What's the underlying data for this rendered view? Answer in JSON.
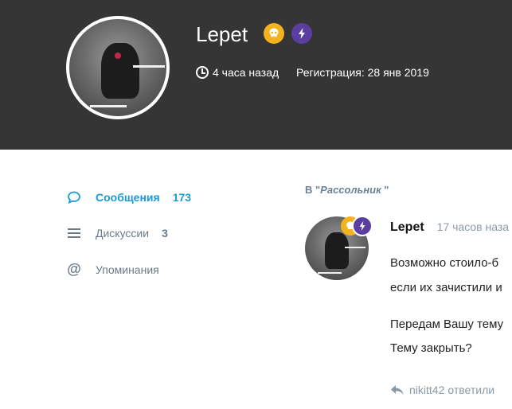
{
  "profile": {
    "username": "Lepet",
    "last_seen": "4 часа назад",
    "registration": "Регистрация: 28 янв 2019",
    "badges": [
      {
        "icon": "skull-icon",
        "color": "#f5b21f"
      },
      {
        "icon": "bolt-icon",
        "color": "#5a3fa0"
      }
    ]
  },
  "nav": [
    {
      "label": "Сообщения",
      "count": "173",
      "icon": "speech-bubble-icon",
      "active": true
    },
    {
      "label": "Дискуссии",
      "count": "3",
      "icon": "list-icon",
      "active": false
    },
    {
      "label": "Упоминания",
      "count": "",
      "icon": "at-icon",
      "active": false
    }
  ],
  "post": {
    "context_prefix": "В \"",
    "discussion": "Рассольник",
    "context_suffix": " \"",
    "author": "Lepet",
    "time": "17 часов наза",
    "lines": [
      "Возможно стоило-б",
      "если их зачистили и",
      "Передам Вашу тему",
      "Тему закрыть?"
    ],
    "reply_user": "nikitt42",
    "reply_action": "ответили"
  },
  "colors": {
    "hero_bg": "#353535",
    "accent": "#1a9bd7",
    "muted": "#6b7a86"
  }
}
